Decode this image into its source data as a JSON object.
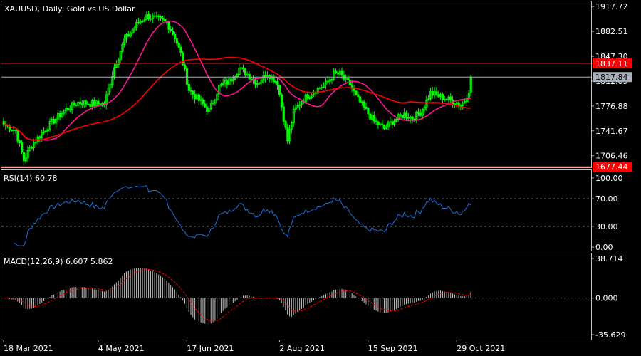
{
  "chart_data": [
    {
      "type": "candlestick",
      "title": "XAUUSD, Daily:  Gold vs US Dollar",
      "ylim": [
        1690.0,
        1925.0
      ],
      "y_ticks": [
        "1917.72",
        "1882.51",
        "1847.30",
        "1812.09",
        "1776.88",
        "1741.67",
        "1706.46"
      ],
      "horizontal_levels": [
        {
          "value": 1837.11,
          "label": "1837.11",
          "color": "#ff0000"
        },
        {
          "value": 1677.44,
          "label": "1677.44",
          "color": "#ff0000"
        }
      ],
      "current_price": {
        "value": 1817.84,
        "label": "1817.84",
        "color": "#a9b0ba"
      },
      "candle_color": "#00ff00",
      "x_labels": [
        "18 Mar 2021",
        "4 May 2021",
        "17 Jun 2021",
        "2 Aug 2021",
        "15 Sep 2021",
        "29 Oct 2021"
      ],
      "x_label_days": [
        0,
        47,
        91,
        137,
        181,
        225
      ],
      "last_day": 232,
      "close_anchors": [
        [
          0,
          1751
        ],
        [
          6,
          1742
        ],
        [
          10,
          1700
        ],
        [
          14,
          1722
        ],
        [
          22,
          1748
        ],
        [
          30,
          1770
        ],
        [
          37,
          1782
        ],
        [
          45,
          1780
        ],
        [
          50,
          1780
        ],
        [
          55,
          1832
        ],
        [
          60,
          1870
        ],
        [
          66,
          1892
        ],
        [
          71,
          1905
        ],
        [
          76,
          1900
        ],
        [
          81,
          1895
        ],
        [
          85,
          1875
        ],
        [
          88,
          1850
        ],
        [
          92,
          1800
        ],
        [
          97,
          1785
        ],
        [
          102,
          1770
        ],
        [
          107,
          1804
        ],
        [
          112,
          1812
        ],
        [
          117,
          1830
        ],
        [
          121,
          1822
        ],
        [
          126,
          1810
        ],
        [
          131,
          1823
        ],
        [
          136,
          1810
        ],
        [
          139,
          1760
        ],
        [
          141,
          1728
        ],
        [
          144,
          1768
        ],
        [
          148,
          1785
        ],
        [
          154,
          1798
        ],
        [
          160,
          1808
        ],
        [
          164,
          1822
        ],
        [
          167,
          1822
        ],
        [
          170,
          1812
        ],
        [
          172,
          1808
        ],
        [
          175,
          1790
        ],
        [
          180,
          1770
        ],
        [
          184,
          1755
        ],
        [
          189,
          1745
        ],
        [
          193,
          1755
        ],
        [
          199,
          1765
        ],
        [
          203,
          1760
        ],
        [
          207,
          1768
        ],
        [
          212,
          1795
        ],
        [
          217,
          1790
        ],
        [
          222,
          1785
        ],
        [
          225,
          1782
        ],
        [
          227,
          1778
        ],
        [
          229,
          1785
        ],
        [
          231,
          1800
        ],
        [
          232,
          1817.84
        ]
      ],
      "series": [
        {
          "name": "MA",
          "color": "#ff1493",
          "period": 20
        },
        {
          "name": "MA",
          "color": "#ff0000",
          "period": 60
        }
      ]
    },
    {
      "type": "line",
      "label": "RSI(14) 60.78",
      "ylim": [
        0,
        100
      ],
      "y_ticks": [
        "100.00",
        "70.00",
        "30.00",
        "0.00"
      ],
      "levels": [
        70,
        30
      ],
      "last_value": 60.78,
      "line_color": "#1e6fd9"
    },
    {
      "type": "bar",
      "label": "MACD(12,26,9) 6.607 5.862",
      "ylim": [
        -35.629,
        38.714
      ],
      "y_ticks": [
        "38.714",
        "0.000",
        "-35.629"
      ],
      "macd_last": 6.607,
      "signal_last": 5.862,
      "histogram_color": "#c0c0c0",
      "signal_color": "#ff0000"
    }
  ]
}
